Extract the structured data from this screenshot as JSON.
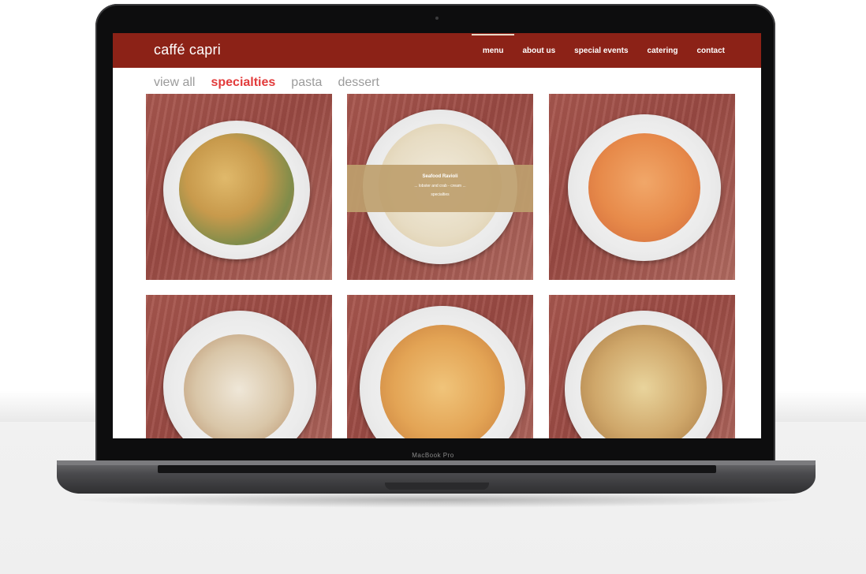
{
  "site": {
    "brand": "caffé capri",
    "nav": [
      "menu",
      "about us",
      "special events",
      "catering",
      "contact"
    ],
    "active_nav": "menu",
    "accent": "#8c2217"
  },
  "filters": {
    "items": [
      "view all",
      "specialties",
      "pasta",
      "dessert"
    ],
    "active": "specialties",
    "active_color": "#e23b3b"
  },
  "menu_tiles": [
    {
      "dish": "tricolor bowtie pasta"
    },
    {
      "dish": "seafood ravioli",
      "overlay": {
        "title": "Seafood Ravioli",
        "description": "... lobster and crab - cream ...",
        "category": "specialties"
      }
    },
    {
      "dish": "penne in pink sauce"
    },
    {
      "dish": "chicken penne with feta"
    },
    {
      "dish": "penne with sun-dried tomato and feta"
    },
    {
      "dish": "chicken and mushroom in cream"
    }
  ],
  "device": {
    "label": "MacBook Pro"
  }
}
